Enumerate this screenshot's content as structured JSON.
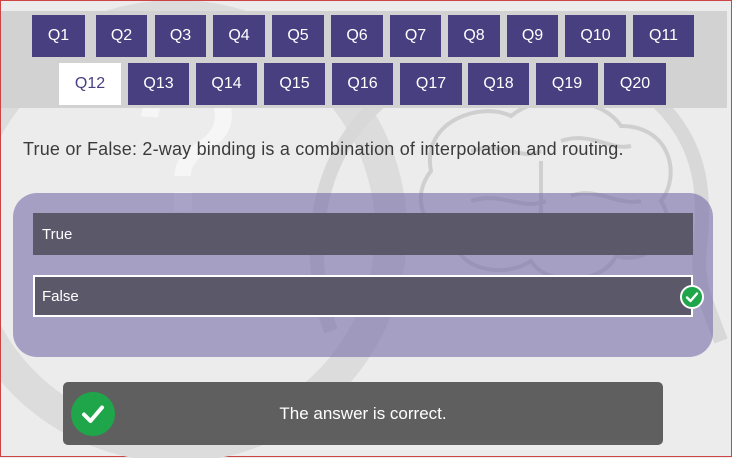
{
  "nav": {
    "row1": [
      "Q1",
      "Q2",
      "Q3",
      "Q4",
      "Q5",
      "Q6",
      "Q7",
      "Q8",
      "Q9",
      "Q10",
      "Q11"
    ],
    "row2": [
      "Q12",
      "Q13",
      "Q14",
      "Q15",
      "Q16",
      "Q17",
      "Q18",
      "Q19",
      "Q20"
    ],
    "active": "Q12"
  },
  "question": {
    "text": "True or False: 2-way binding is a combination of interpolation and routing."
  },
  "options": [
    {
      "label": "True",
      "selected": false
    },
    {
      "label": "False",
      "selected": true,
      "correct": true
    }
  ],
  "feedback": {
    "text": "The answer is correct.",
    "icon": "checkmark-icon"
  },
  "colors": {
    "nav_button": "#473f7f",
    "nav_active": "#ffffff",
    "nav_bar": "#d2d2d2",
    "option_bg": "#5a5869",
    "panel_bg": "#7870aa",
    "success": "#1fa64a",
    "feedback_bg": "#5f5f5f"
  }
}
